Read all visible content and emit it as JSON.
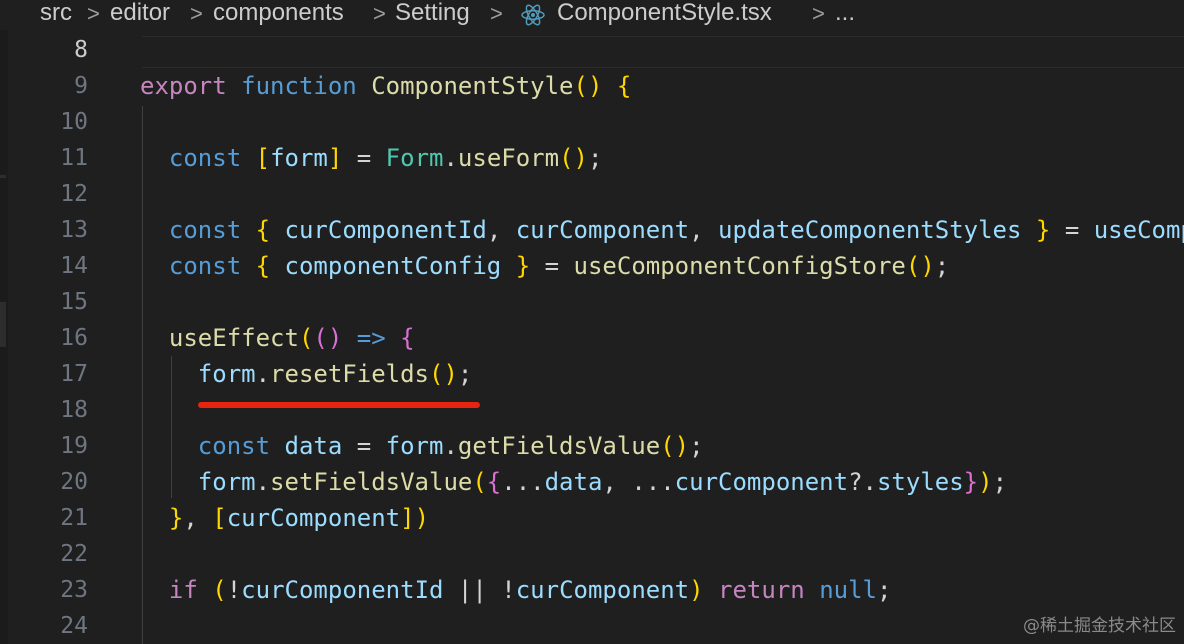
{
  "breadcrumb": {
    "items": [
      "src",
      "editor",
      "components",
      "Setting",
      "ComponentStyle.tsx",
      "..."
    ],
    "icon": "react-icon"
  },
  "editor": {
    "line_numbers": [
      "8",
      "9",
      "10",
      "11",
      "12",
      "13",
      "14",
      "15",
      "16",
      "17",
      "18",
      "19",
      "20",
      "21",
      "22",
      "23",
      "24"
    ],
    "active_line": "8",
    "lines": [
      "",
      "export function ComponentStyle() {",
      "",
      "  const [form] = Form.useForm();",
      "",
      "  const { curComponentId, curComponent, updateComponentStyles } = useComp",
      "  const { componentConfig } = useComponentConfigStore();",
      "",
      "  useEffect(() => {",
      "    form.resetFields();",
      "",
      "    const data = form.getFieldsValue();",
      "    form.setFieldsValue({...data, ...curComponent?.styles});",
      "  }, [curComponent])",
      "",
      "  if (!curComponentId || !curComponent) return null;",
      ""
    ]
  },
  "annotation": {
    "underline_color": "#e8230f"
  },
  "watermark": "@稀土掘金技术社区",
  "colors": {
    "background": "#1f1f1f",
    "keyword": "#569cd6",
    "function": "#dcdcaa",
    "variable": "#9cdcfe",
    "control": "#c586c0"
  }
}
